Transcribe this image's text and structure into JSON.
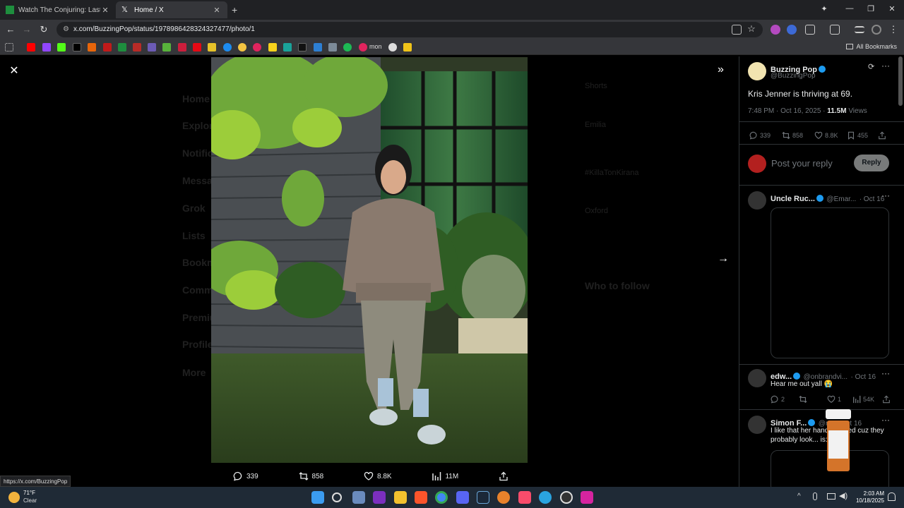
{
  "browser": {
    "tabs": [
      {
        "title": "Watch The Conjuring: Last Rites",
        "active": false
      },
      {
        "title": "Home / X",
        "active": true
      }
    ],
    "url": "x.com/BuzzingPop/status/1978986428324327477/photo/1",
    "all_bookmarks_label": "All Bookmarks",
    "bookmark_text": "mon"
  },
  "viewer": {
    "actions": {
      "replies": "339",
      "reposts": "858",
      "likes": "8.8K",
      "views": "11M"
    }
  },
  "background_ghost": {
    "nav": [
      "Home",
      "Explore",
      "Notifications",
      "Messages",
      "Grok",
      "Lists",
      "Bookmarks",
      "Communities",
      "Premium",
      "Profile",
      "More"
    ],
    "right": [
      "Shorts",
      "Emilia",
      "#KillaTonKirana",
      "Oxford",
      "Who to follow"
    ]
  },
  "tweet": {
    "author_name": "Buzzing Pop",
    "author_handle": "@BuzzingPop",
    "text": "Kris Jenner is thriving at 69.",
    "timestamp": "7:48 PM · Oct 16, 2025 ·",
    "views_count": "11.5M",
    "views_label": "Views",
    "stats": {
      "replies": "339",
      "reposts": "858",
      "likes": "8.8K",
      "bookmarks": "455"
    },
    "reply_placeholder": "Post your reply",
    "reply_button": "Reply"
  },
  "replies": [
    {
      "name": "Uncle Ruc...",
      "handle": "@Emar...",
      "date": "· Oct 16",
      "text": ""
    },
    {
      "name": "edw...",
      "handle": "@onbrandvi...",
      "date": "· Oct 16",
      "text": "Hear me out yall 😭",
      "stats": {
        "replies": "2",
        "reposts": "",
        "likes": "1",
        "views": "54K"
      }
    },
    {
      "name": "Simon F...",
      "handle": "@re...",
      "date": "Oct 16",
      "text": "I like that her hand covered cuz they probably look... is:"
    }
  ],
  "statusbar_url": "https://x.com/BuzzingPop",
  "taskbar": {
    "temp": "71°F",
    "condition": "Clear",
    "time": "2:03 AM",
    "date": "10/18/2025"
  }
}
